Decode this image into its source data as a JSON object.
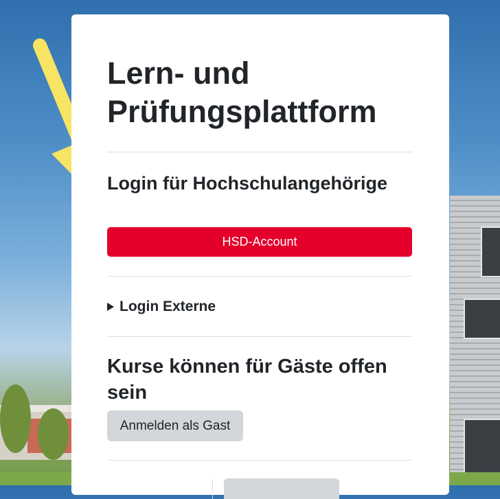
{
  "page": {
    "title": "Lern- und Prüfungsplattform"
  },
  "login_members": {
    "heading": "Login für Hochschulangehörige",
    "button_label": "HSD-Account",
    "button_color": "#e4002b"
  },
  "login_external": {
    "summary_label": "Login Externe"
  },
  "guest": {
    "heading": "Kurse können für Gäste offen sein",
    "button_label": "Anmelden als Gast"
  },
  "annotation": {
    "arrow_color": "#f7e463",
    "icon": "arrow-down-right-icon"
  }
}
